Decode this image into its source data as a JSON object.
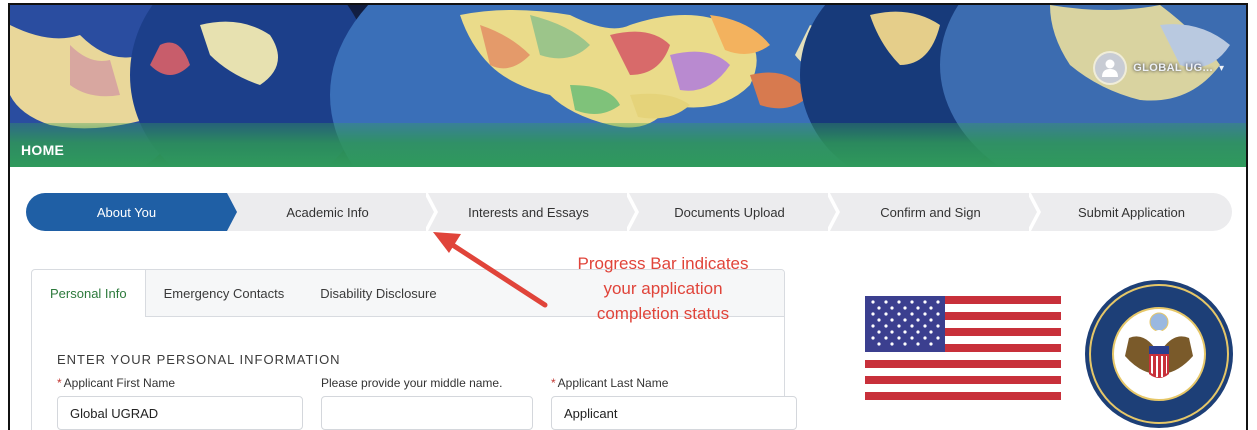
{
  "header": {
    "section_title": "HOME",
    "user_name": "GLOBAL UG...",
    "user_icon": "user-avatar-icon",
    "caret_icon": "chevron-down-icon"
  },
  "progress": {
    "steps": [
      {
        "label": "About You",
        "active": true
      },
      {
        "label": "Academic Info",
        "active": false
      },
      {
        "label": "Interests and Essays",
        "active": false
      },
      {
        "label": "Documents Upload",
        "active": false
      },
      {
        "label": "Confirm and Sign",
        "active": false
      },
      {
        "label": "Submit Application",
        "active": false
      }
    ]
  },
  "tabs": [
    {
      "label": "Personal Info",
      "active": true
    },
    {
      "label": "Emergency Contacts",
      "active": false
    },
    {
      "label": "Disability Disclosure",
      "active": false
    }
  ],
  "form": {
    "section_title": "ENTER YOUR PERSONAL INFORMATION",
    "fields": [
      {
        "label": "Applicant First Name",
        "required": true,
        "value": "Global UGRAD"
      },
      {
        "label": "Please provide your middle name.",
        "required": false,
        "value": ""
      },
      {
        "label": "Applicant Last Name",
        "required": true,
        "value": "Applicant"
      }
    ]
  },
  "annotation": {
    "lines": [
      "Progress Bar indicates",
      "your application",
      "completion status"
    ],
    "color": "#e0443a"
  },
  "colors": {
    "active_step": "#1f5fa5",
    "inactive_step": "#ececee",
    "home_bar": "#2f9a5c",
    "active_tab_text": "#2d7a3c",
    "required_marker": "#c23934"
  }
}
